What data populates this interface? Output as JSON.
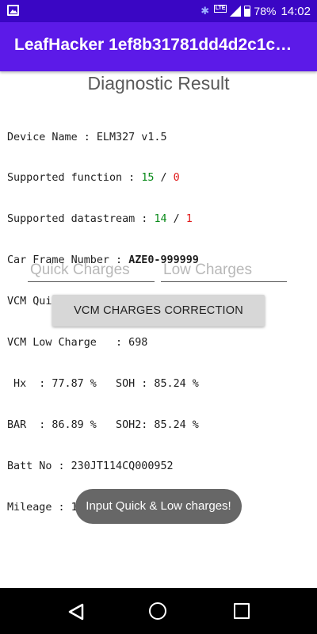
{
  "status_bar": {
    "battery": "78%",
    "time": "14:02",
    "network": "LTE",
    "icons": [
      "gallery-icon",
      "bluetooth-icon",
      "lte-icon",
      "signal-icon",
      "battery-icon"
    ]
  },
  "toolbar": {
    "title": "LeafHacker 1ef8b31781dd4d2c1c…"
  },
  "diagnostic": {
    "heading": "Diagnostic Result",
    "device_name_label": "Device Name : ",
    "device_name_value": "ELM327 v1.5",
    "supported_function_label": "Supported function : ",
    "supported_function_ok": "15",
    "supported_function_sep": " / ",
    "supported_function_fail": "0",
    "supported_datastream_label": "Supported datastream : ",
    "supported_datastream_ok": "14",
    "supported_datastream_sep": " / ",
    "supported_datastream_fail": "1",
    "car_frame_label": "Car Frame Number : ",
    "car_frame_value": "AZE0-999999",
    "vcm_quick_line": "VCM Quick Charge : 11",
    "vcm_low_line": "VCM Low Charge   : 698",
    "hx_soh_line": " Hx  : 77.87 %   SOH : 85.24 %",
    "bar_soh2_line": "BAR  : 86.89 %   SOH2: 85.24 %",
    "batt_no_line": "Batt No : 230JT114CQ000952",
    "mileage_line": "Mileage : 11111 km"
  },
  "inputs": {
    "quick_placeholder": "Quick Charges",
    "low_placeholder": "Low Charges"
  },
  "button": {
    "label": "VCM CHARGES CORRECTION"
  },
  "toast": {
    "message": "Input Quick & Low charges!"
  },
  "nav": {
    "icons": [
      "back-icon",
      "home-icon",
      "recents-icon"
    ]
  },
  "colors": {
    "status_bar": "#3a06c4",
    "toolbar": "#5c1ae8",
    "ok": "#0a8a1a",
    "fail": "#e01818"
  }
}
